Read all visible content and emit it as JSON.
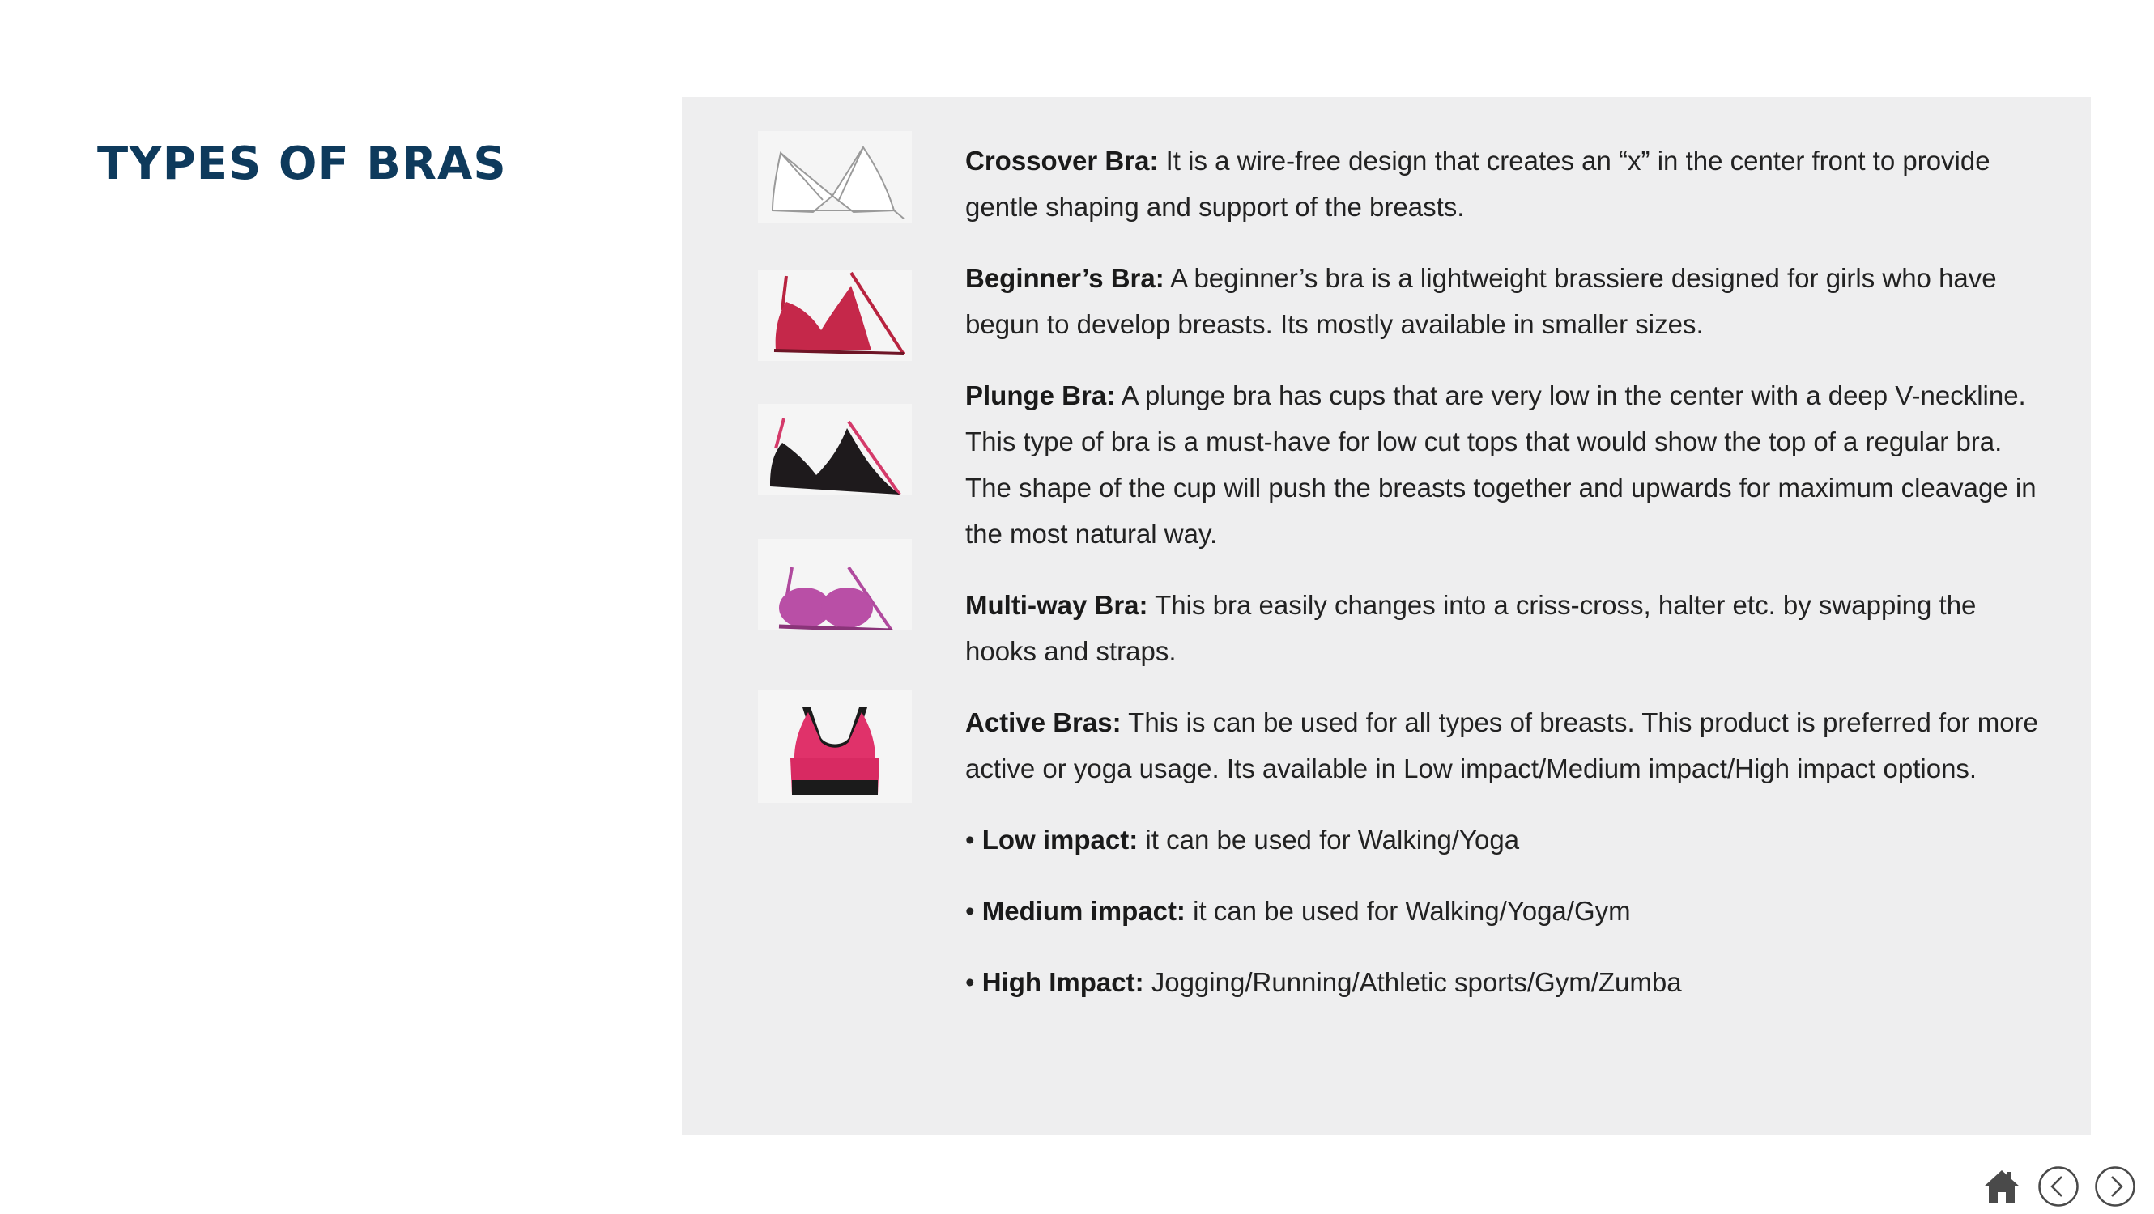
{
  "page": {
    "title": "TYPES OF BRAS"
  },
  "items": [
    {
      "name": "Crossover Bra:",
      "text": " It is a wire-free design that creates an “x” in the center front to provide gentle shaping and support of the breasts.",
      "icon": "white-crossover-bra-icon"
    },
    {
      "name": "Beginner’s Bra:",
      "text": "A beginner’s bra is a lightweight brassiere designed for girls who have begun to develop breasts. Its mostly available in smaller sizes.",
      "icon": "red-beginner-bra-icon"
    },
    {
      "name": "Plunge Bra:",
      "text": "A plunge bra has cups that are very low in the center with a deep V-neckline. This type of bra is a must-have for low cut tops that would show the top of a regular bra. The shape of the cup will push the breasts together and upwards for maximum cleavage in the most natural way.",
      "icon": "black-plunge-bra-icon"
    },
    {
      "name": "Multi-way Bra:",
      "text": "This bra easily changes into a criss-cross, halter etc. by swapping the hooks and straps.",
      "icon": "purple-multiway-bra-icon"
    },
    {
      "name": "Active Bras:",
      "text": "This is can be used for all types of breasts. This product is preferred for more active or yoga usage. Its available in Low impact/Medium impact/High impact options.",
      "icon": "pink-sports-bra-icon"
    }
  ],
  "bullets": [
    {
      "name": "Low impact:",
      "text": "it can be used for Walking/Yoga"
    },
    {
      "name": "Medium impact:",
      "text": "it can be used for Walking/Yoga/Gym"
    },
    {
      "name": "High Impact:",
      "text": "Jogging/Running/Athletic sports/Gym/Zumba"
    }
  ],
  "bullet_char": "•",
  "nav": {
    "home_icon": "home-icon",
    "prev_icon": "chevron-left-icon",
    "next_icon": "chevron-right-icon"
  },
  "colors": {
    "title": "#0e3a5c",
    "panel_bg": "#eeeeef",
    "text": "#222222",
    "nav_icon": "#4a4a4a"
  }
}
